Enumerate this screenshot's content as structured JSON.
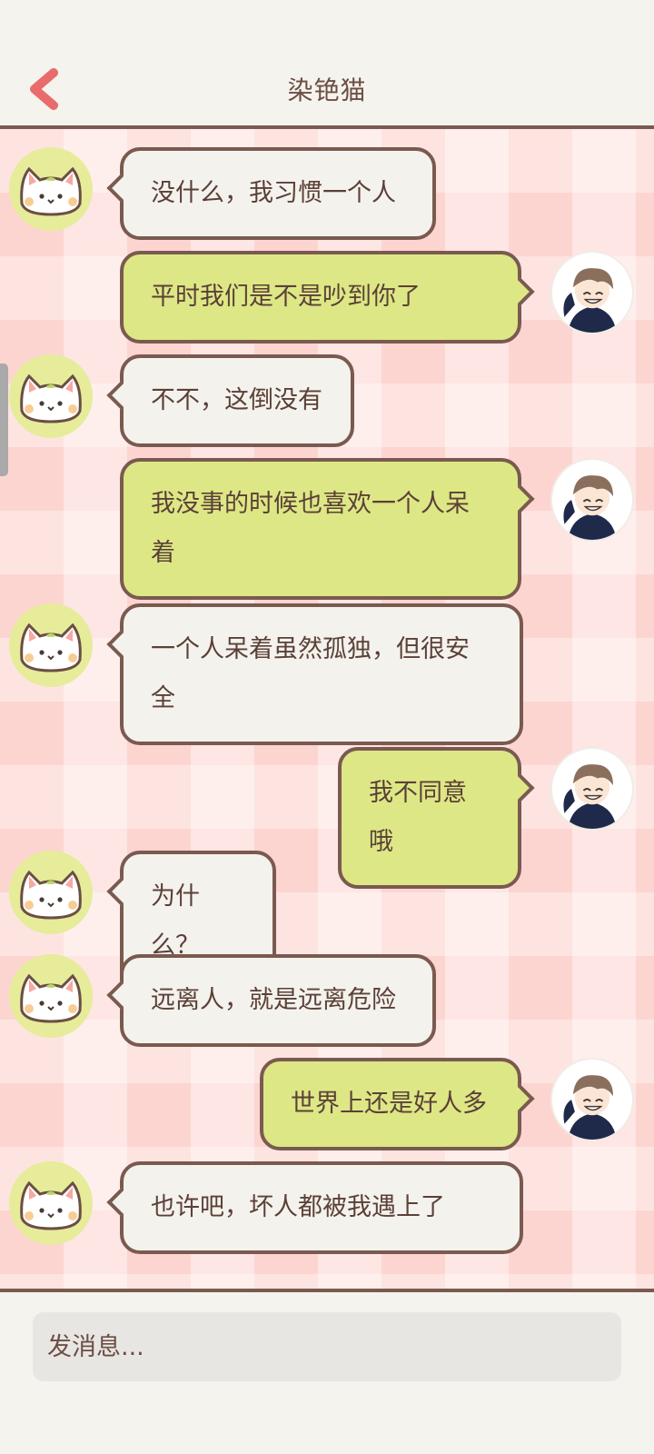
{
  "header": {
    "title": "染铯猫"
  },
  "input": {
    "placeholder": "发消息..."
  },
  "colors": {
    "accent_back": "#e86c6c",
    "bubble_outline": "#7a5a50",
    "bubble_other": "#f4f2ec",
    "bubble_self": "#dde785"
  },
  "messages": [
    {
      "side": "left",
      "text": "没什么，我习惯一个人"
    },
    {
      "side": "right",
      "text": "平时我们是不是吵到你了"
    },
    {
      "side": "left",
      "text": "不不，这倒没有"
    },
    {
      "side": "right",
      "text": "我没事的时候也喜欢一个人呆着"
    },
    {
      "side": "left",
      "text": "一个人呆着虽然孤独，但很安全"
    },
    {
      "side": "right",
      "text": "我不同意哦"
    },
    {
      "side": "left",
      "text": "为什么？"
    },
    {
      "side": "left",
      "text": "远离人，就是远离危险"
    },
    {
      "side": "right",
      "text": "世界上还是好人多"
    },
    {
      "side": "left",
      "text": "也许吧，坏人都被我遇上了"
    }
  ]
}
